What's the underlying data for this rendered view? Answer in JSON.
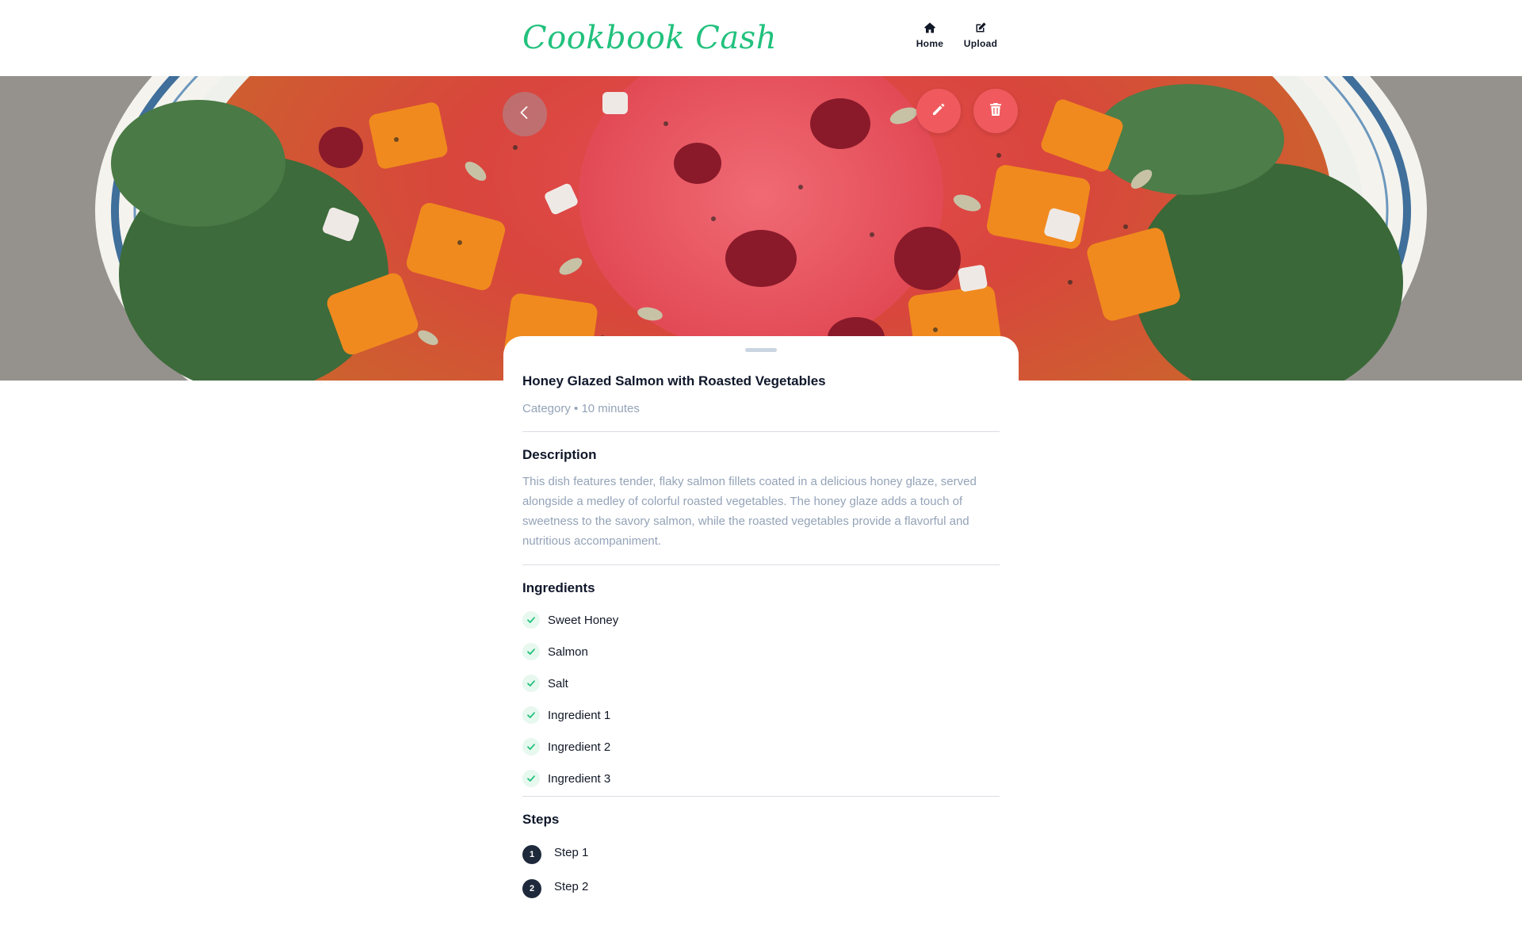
{
  "app": {
    "brand": "Cookbook Cash",
    "brand_color": "#22c17d"
  },
  "nav": {
    "items": [
      {
        "label": "Home",
        "icon": "home-icon"
      },
      {
        "label": "Upload",
        "icon": "edit-square-icon"
      }
    ]
  },
  "hero": {
    "image": "recipe-photo",
    "actions": {
      "back_icon": "chevron-left-icon",
      "edit_icon": "pencil-icon",
      "delete_icon": "trash-icon",
      "action_color": "#f05a5e"
    }
  },
  "recipe": {
    "title": "Honey Glazed Salmon with Roasted Vegetables",
    "meta": "Category • 10 minutes",
    "description_heading": "Description",
    "description": "This dish features tender, flaky salmon fillets coated in a delicious honey glaze, served alongside a medley of colorful roasted vegetables. The honey glaze adds a touch of sweetness to the savory salmon, while the roasted vegetables provide a flavorful and nutritious accompaniment.",
    "ingredients_heading": "Ingredients",
    "ingredients": [
      "Sweet Honey",
      "Salmon",
      "Salt",
      "Ingredient 1",
      "Ingredient 2",
      "Ingredient 3"
    ],
    "steps_heading": "Steps",
    "steps": [
      {
        "number": "1",
        "text": "Step 1"
      },
      {
        "number": "2",
        "text": "Step 2"
      }
    ]
  }
}
